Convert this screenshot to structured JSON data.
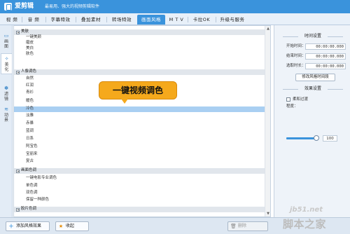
{
  "app": {
    "name": "爱剪辑",
    "slogan": "最易用、强大的视频剪辑软件"
  },
  "colors": {
    "accent": "#3a93dc",
    "callout": "#f5a91c",
    "selected_row": "#a9cff2",
    "category_row": "#e1e6ec"
  },
  "tabs": [
    {
      "label": "视 频",
      "active": false
    },
    {
      "label": "音 频",
      "active": false
    },
    {
      "label": "字幕特效",
      "active": false
    },
    {
      "label": "叠加素材",
      "active": false
    },
    {
      "label": "转场特效",
      "active": false
    },
    {
      "label": "画面风格",
      "active": true
    },
    {
      "label": "M T V",
      "active": false
    },
    {
      "label": "卡拉OK",
      "active": false
    },
    {
      "label": "升级与服务",
      "active": false
    }
  ],
  "side_tabs": [
    {
      "label_top": "画",
      "label_bottom": "面",
      "icon": "frame-icon",
      "active": false
    },
    {
      "label_top": "美",
      "label_bottom": "化",
      "icon": "magic-wand-icon",
      "active": true
    },
    {
      "label_top": "滤",
      "label_bottom": "镜",
      "icon": "filter-icon",
      "active": false
    },
    {
      "label_top": "动",
      "label_bottom": "景",
      "icon": "motion-icon",
      "active": false
    }
  ],
  "list": [
    {
      "label": "美肤",
      "type": "category"
    },
    {
      "label": "一键美颜",
      "type": "item"
    },
    {
      "label": "磨皮",
      "type": "item"
    },
    {
      "label": "美白",
      "type": "item"
    },
    {
      "label": "肤色",
      "type": "item"
    },
    {
      "label": "人像调色",
      "type": "category"
    },
    {
      "label": "自然",
      "type": "item"
    },
    {
      "label": "红润",
      "type": "item"
    },
    {
      "label": "青衫",
      "type": "item"
    },
    {
      "label": "暖色",
      "type": "item"
    },
    {
      "label": "冷色",
      "type": "item",
      "selected": true
    },
    {
      "label": "淡雅",
      "type": "item"
    },
    {
      "label": "赤暴",
      "type": "item"
    },
    {
      "label": "蓝调",
      "type": "item"
    },
    {
      "label": "日系",
      "type": "item"
    },
    {
      "label": "阿宝色",
      "type": "item"
    },
    {
      "label": "宝丽来",
      "type": "item"
    },
    {
      "label": "复古",
      "type": "item"
    },
    {
      "label": "画面色调",
      "type": "category"
    },
    {
      "label": "一键电影专业调色",
      "type": "item"
    },
    {
      "label": "单色调",
      "type": "item"
    },
    {
      "label": "双色调",
      "type": "item"
    },
    {
      "label": "保留一种颜色",
      "type": "item"
    },
    {
      "label": "胶片色调",
      "type": "category"
    }
  ],
  "callout": {
    "text": "一键视频调色"
  },
  "time_settings": {
    "title": "时间设置",
    "start_label": "开始时间：",
    "start_value": "00:00:00.000",
    "end_label": "结束时间：",
    "end_value": "00:00:00.000",
    "duration_label": "选取时长：",
    "duration_value": "00:00:00.000",
    "button": "修改风格时间段"
  },
  "effect_settings": {
    "title": "效果设置",
    "smooth_label": "柔和过渡",
    "smooth_checked": false,
    "level_label": "程度：",
    "level_value": "100",
    "level_fraction": 0.93
  },
  "bottom": {
    "add_button": "添加风格效果",
    "fav_button": "收起",
    "delete_button": "删除"
  },
  "watermark": {
    "site": "jb51.net",
    "name": "脚本之家"
  }
}
